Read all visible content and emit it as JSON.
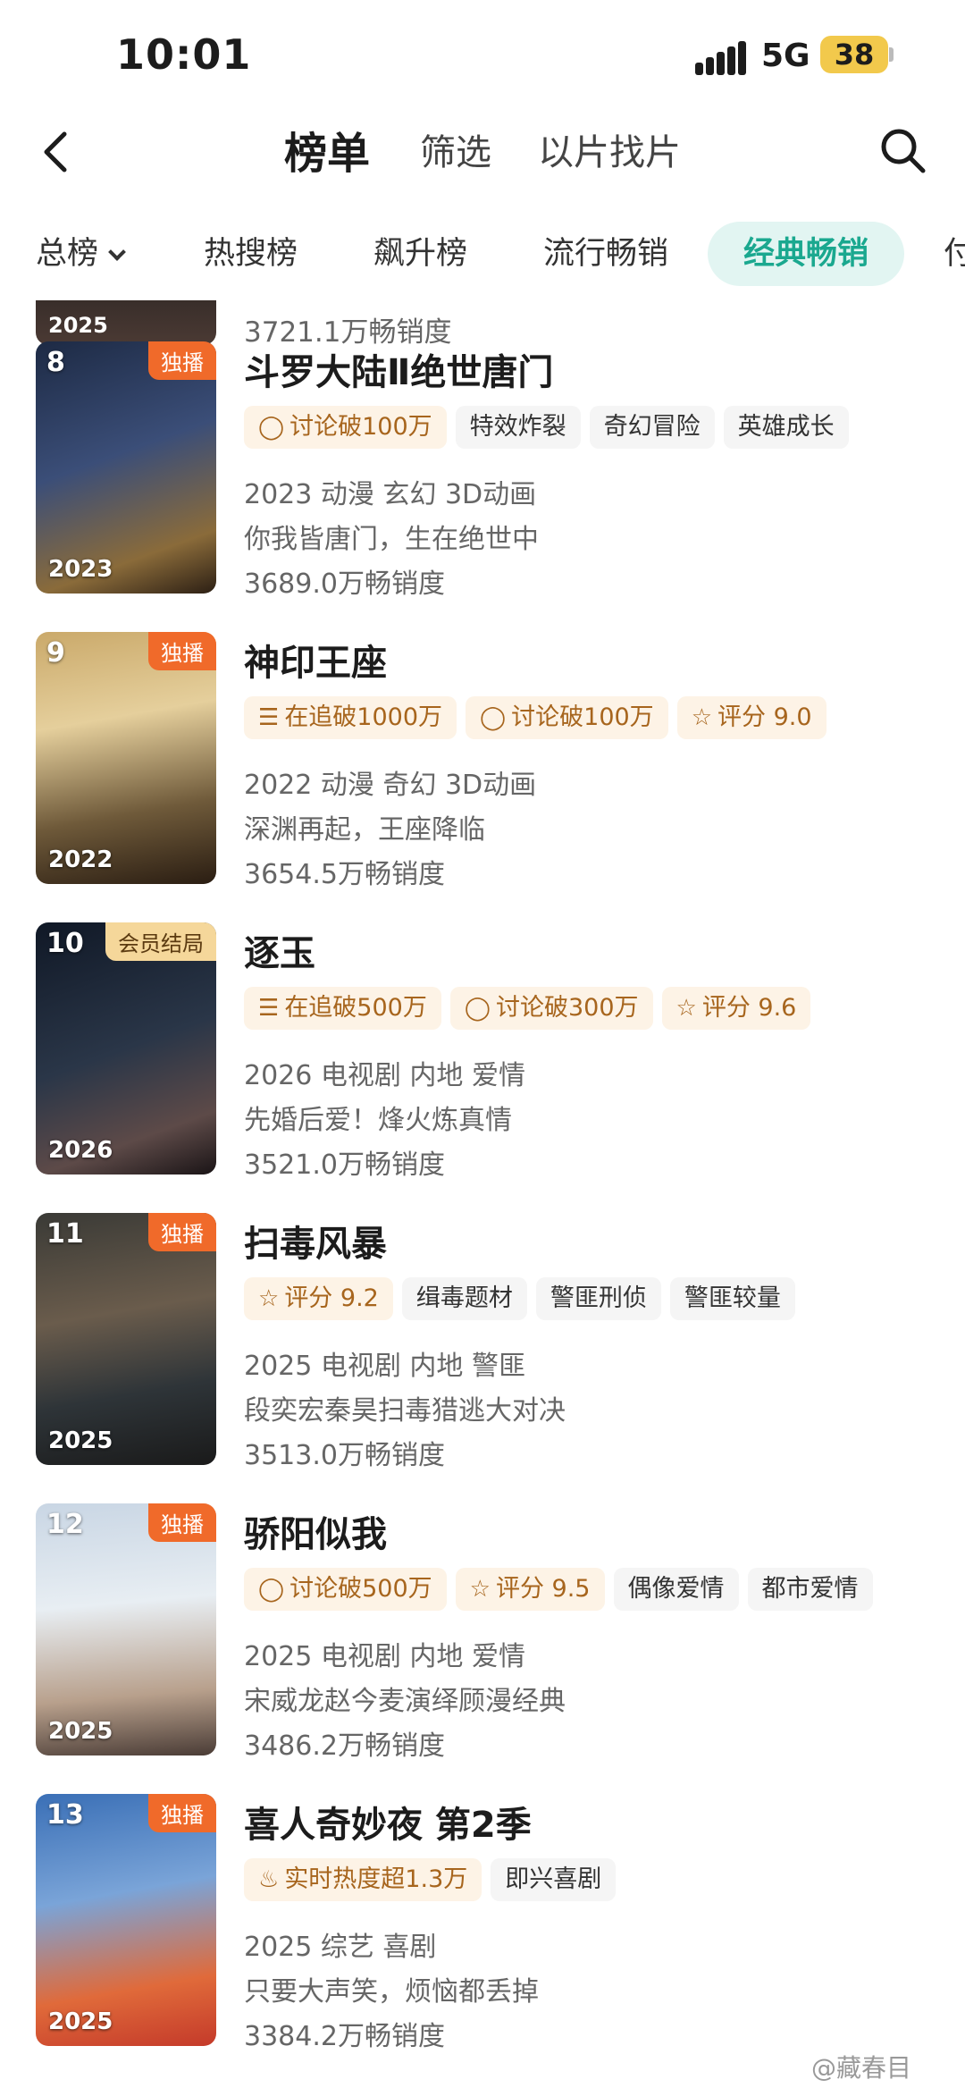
{
  "status": {
    "time": "10:01",
    "network": "5G",
    "battery": "38"
  },
  "header": {
    "tabs": [
      "榜单",
      "筛选",
      "以片找片"
    ]
  },
  "categories": [
    "总榜",
    "热搜榜",
    "飙升榜",
    "流行畅销",
    "经典畅销",
    "付"
  ],
  "partial_item": {
    "year": "2025",
    "sales": "3721.1万畅销度"
  },
  "items": [
    {
      "rank": "8",
      "badge": "独播",
      "year": "2023",
      "title": "斗罗大陆Ⅱ绝世唐门",
      "tags": [
        {
          "icon": "comment-icon",
          "text": "讨论破100万",
          "hot": true
        },
        {
          "text": "特效炸裂"
        },
        {
          "text": "奇幻冒险"
        },
        {
          "text": "英雄成长"
        }
      ],
      "meta": "2023 动漫 玄幻 3D动画",
      "slogan": "你我皆唐门，生在绝世中",
      "sales": "3689.0万畅销度"
    },
    {
      "rank": "9",
      "badge": "独播",
      "year": "2022",
      "title": "神印王座",
      "tags": [
        {
          "icon": "follow-list-icon",
          "text": "在追破1000万",
          "hot": true
        },
        {
          "icon": "comment-icon",
          "text": "讨论破100万",
          "hot": true
        },
        {
          "icon": "star-icon",
          "text": "评分 9.0",
          "hot": true
        }
      ],
      "meta": "2022 动漫 奇幻 3D动画",
      "slogan": "深渊再起，王座降临",
      "sales": "3654.5万畅销度"
    },
    {
      "rank": "10",
      "badge": "会员结局",
      "year": "2026",
      "title": "逐玉",
      "tags": [
        {
          "icon": "follow-list-icon",
          "text": "在追破500万",
          "hot": true
        },
        {
          "icon": "comment-icon",
          "text": "讨论破300万",
          "hot": true
        },
        {
          "icon": "star-icon",
          "text": "评分 9.6",
          "hot": true
        }
      ],
      "meta": "2026 电视剧 内地 爱情",
      "slogan": "先婚后爱！烽火炼真情",
      "sales": "3521.0万畅销度"
    },
    {
      "rank": "11",
      "badge": "独播",
      "year": "2025",
      "title": "扫毒风暴",
      "tags": [
        {
          "icon": "star-icon",
          "text": "评分 9.2",
          "hot": true
        },
        {
          "text": "缉毒题材"
        },
        {
          "text": "警匪刑侦"
        },
        {
          "text": "警匪较量"
        }
      ],
      "meta": "2025 电视剧 内地 警匪",
      "slogan": "段奕宏秦昊扫毒猎逃大对决",
      "sales": "3513.0万畅销度"
    },
    {
      "rank": "12",
      "badge": "独播",
      "year": "2025",
      "title": "骄阳似我",
      "tags": [
        {
          "icon": "comment-icon",
          "text": "讨论破500万",
          "hot": true
        },
        {
          "icon": "star-icon",
          "text": "评分 9.5",
          "hot": true
        },
        {
          "text": "偶像爱情"
        },
        {
          "text": "都市爱情"
        }
      ],
      "meta": "2025 电视剧 内地 爱情",
      "slogan": "宋威龙赵今麦演绎顾漫经典",
      "sales": "3486.2万畅销度"
    },
    {
      "rank": "13",
      "badge": "独播",
      "year": "2025",
      "title": "喜人奇妙夜 第2季",
      "tags": [
        {
          "icon": "fire-icon",
          "text": "实时热度超1.3万",
          "hot": true
        },
        {
          "text": "即兴喜剧"
        }
      ],
      "meta": "2025 综艺 喜剧",
      "slogan": "只要大声笑，烦恼都丢掉",
      "sales": "3384.2万畅销度"
    }
  ],
  "watermark": "@藏春目",
  "colors": {
    "accent": "#1aa88f",
    "badge": "#f06a2a",
    "member_badge": "#f5d79a",
    "hot_tag_bg": "#fdf3e6"
  }
}
